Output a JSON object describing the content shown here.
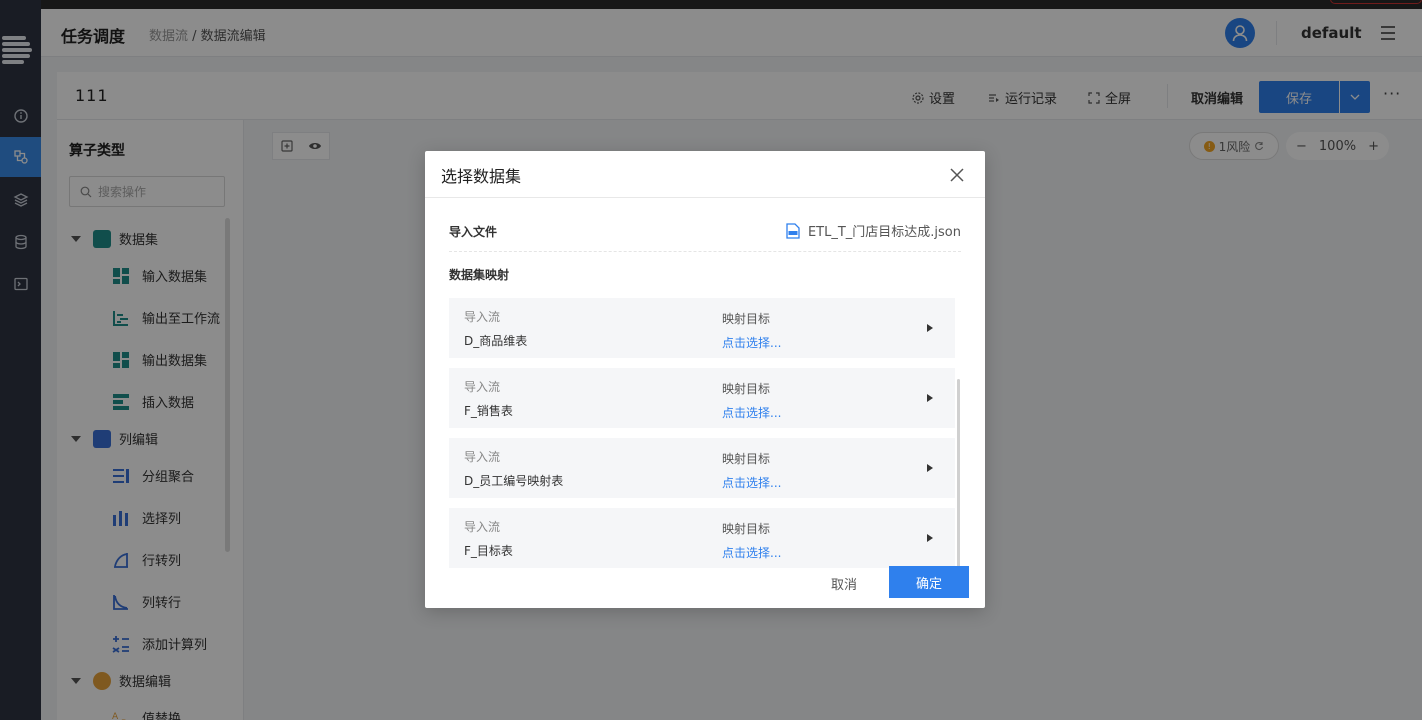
{
  "header": {
    "title": "任务调度",
    "breadcrumb_parent": "数据流",
    "breadcrumb_sep": " / ",
    "breadcrumb_current": "数据流编辑",
    "user": "default"
  },
  "toolbar": {
    "flow_name": "111",
    "settings": "设置",
    "run_log": "运行记录",
    "fullscreen": "全屏",
    "cancel_edit": "取消编辑",
    "save": "保存",
    "more": "···"
  },
  "panel": {
    "title": "算子类型",
    "search_placeholder": "搜索操作",
    "groups": [
      {
        "label": "数据集",
        "color": "#1f8f8a"
      },
      {
        "label": "列编辑",
        "color": "#3a6fd8"
      },
      {
        "label": "数据编辑",
        "color": "#e7a23b"
      }
    ],
    "ops": [
      "输入数据集",
      "输出至工作流",
      "输出数据集",
      "插入数据",
      "分组聚合",
      "选择列",
      "行转列",
      "列转行",
      "添加计算列",
      "值替换"
    ]
  },
  "canvas": {
    "risk": "1风险",
    "zoom": "100%",
    "zoom_minus": "−",
    "zoom_plus": "+"
  },
  "modal": {
    "title": "选择数据集",
    "file_label": "导入文件",
    "file_name": "ETL_T_门店目标达成.json",
    "mapping_label": "数据集映射",
    "key_import": "导入流",
    "key_target": "映射目标",
    "select_link": "点击选择...",
    "rows": [
      "D_商品维表",
      "F_销售表",
      "D_员工编号映射表",
      "F_目标表"
    ],
    "cancel": "取消",
    "ok": "确定"
  },
  "colors": {
    "primary": "#2f80ed",
    "nav": "#2e3442"
  }
}
